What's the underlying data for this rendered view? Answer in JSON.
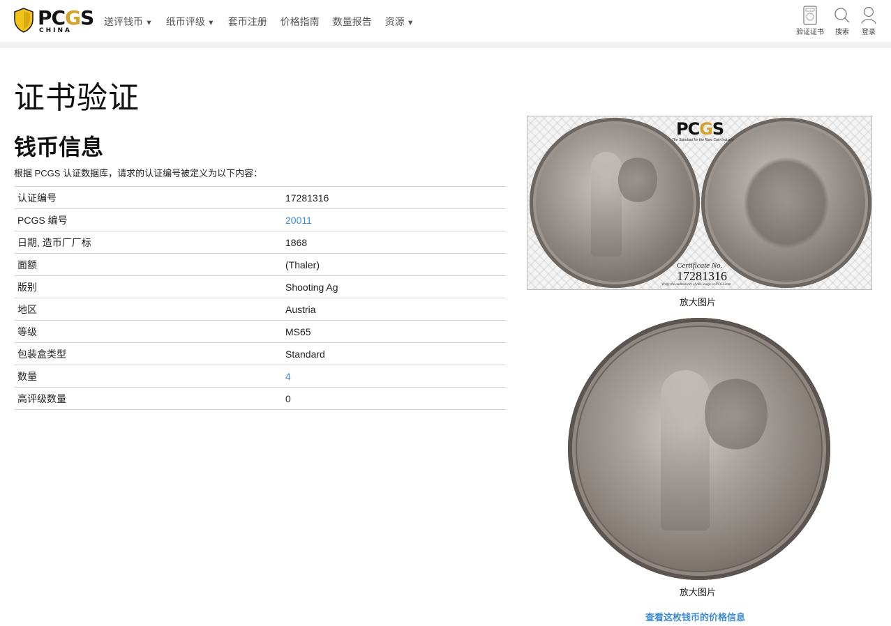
{
  "header": {
    "logo_text": "PCGS",
    "logo_sub": "CHINA",
    "nav": [
      {
        "label": "送评钱币",
        "caret": "▼"
      },
      {
        "label": "纸币评级",
        "caret": "▼"
      },
      {
        "label": "套币注册",
        "caret": ""
      },
      {
        "label": "价格指南",
        "caret": ""
      },
      {
        "label": "数量报告",
        "caret": ""
      },
      {
        "label": "资源",
        "caret": "▼"
      }
    ],
    "tools": [
      {
        "label": "验证证书",
        "icon": "certificate-icon"
      },
      {
        "label": "搜索",
        "icon": "search-icon"
      },
      {
        "label": "登录",
        "icon": "user-icon"
      }
    ]
  },
  "main": {
    "page_title": "证书验证",
    "section_title": "钱币信息",
    "intro": "根据 PCGS 认证数据库，请求的认证编号被定义为以下内容：",
    "rows": [
      {
        "key": "认证编号",
        "value": "17281316",
        "link": false
      },
      {
        "key": "PCGS 编号",
        "value": "20011",
        "link": true
      },
      {
        "key": "日期, 造币厂厂标",
        "value": "1868",
        "link": false
      },
      {
        "key": "面额",
        "value": "(Thaler)",
        "link": false
      },
      {
        "key": "版别",
        "value": "Shooting Ag",
        "link": false
      },
      {
        "key": "地区",
        "value": "Austria",
        "link": false
      },
      {
        "key": "等级",
        "value": "MS65",
        "link": false
      },
      {
        "key": "包装盒类型",
        "value": "Standard",
        "link": false
      },
      {
        "key": "数量",
        "value": "4",
        "link": true
      },
      {
        "key": "高评级数量",
        "value": "0",
        "link": false
      }
    ]
  },
  "images": {
    "slab_logo": "PCGS",
    "slab_tag": "The Standard for the Rare Coin Industry",
    "slab_cert_label": "Certificate No.",
    "slab_cert_num": "17281316",
    "slab_verify": "Verify the authenticity of this image at PCGS.com",
    "enlarge_1": "放大图片",
    "enlarge_2": "放大图片",
    "price_link": "查看这枚钱币的价格信息"
  },
  "colors": {
    "link": "#3b8bd6",
    "logo_gold": "#d4a12a",
    "shield_yellow": "#f2c418"
  }
}
